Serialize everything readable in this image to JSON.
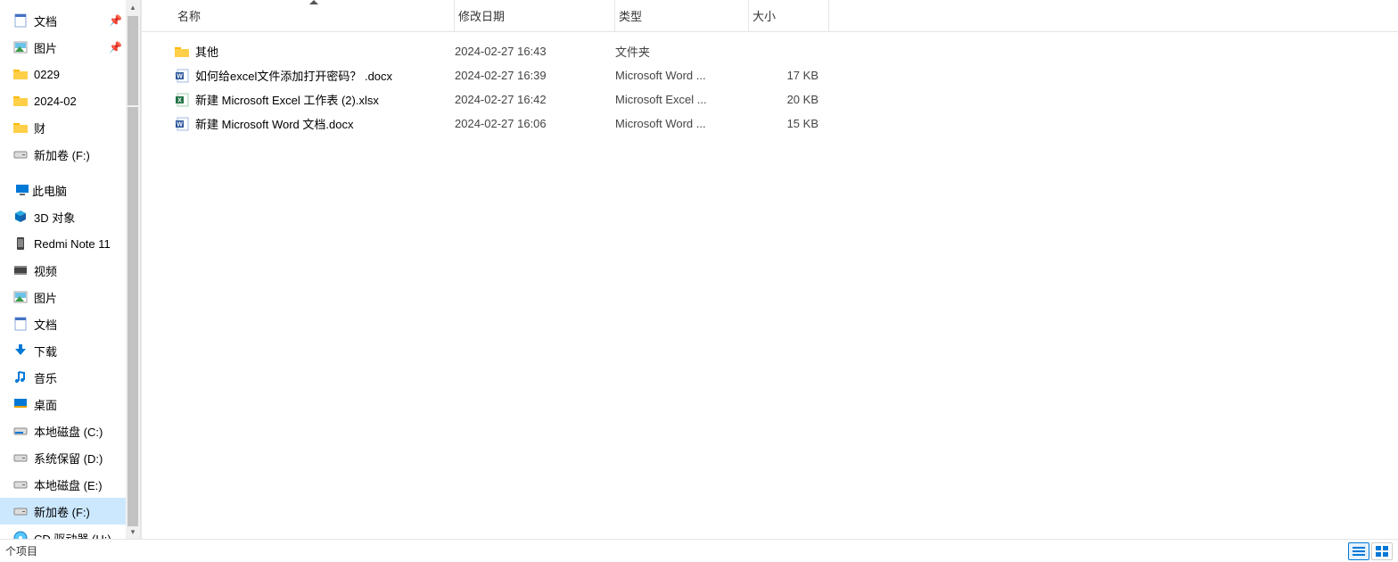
{
  "sidebar": {
    "quick": [
      {
        "label": "文档",
        "icon": "doc",
        "pin": true
      },
      {
        "label": "图片",
        "icon": "pic",
        "pin": true
      },
      {
        "label": "0229",
        "icon": "folder"
      },
      {
        "label": "2024-02",
        "icon": "folder"
      },
      {
        "label": "财",
        "icon": "folder"
      },
      {
        "label": "新加卷 (F:)",
        "icon": "drive"
      }
    ],
    "pc_label": "此电脑",
    "pc_children": [
      {
        "label": "3D 对象",
        "icon": "cube"
      },
      {
        "label": "Redmi Note 11",
        "icon": "phone"
      },
      {
        "label": "视频",
        "icon": "vid"
      },
      {
        "label": "图片",
        "icon": "pic"
      },
      {
        "label": "文档",
        "icon": "doc"
      },
      {
        "label": "下载",
        "icon": "dl"
      },
      {
        "label": "音乐",
        "icon": "mus"
      },
      {
        "label": "桌面",
        "icon": "desk"
      },
      {
        "label": "本地磁盘 (C:)",
        "icon": "driveC"
      },
      {
        "label": "系统保留 (D:)",
        "icon": "drive"
      },
      {
        "label": "本地磁盘 (E:)",
        "icon": "drive"
      },
      {
        "label": "新加卷 (F:)",
        "icon": "drive",
        "selected": true
      },
      {
        "label": "CD 驱动器 (H:) ",
        "icon": "cd"
      }
    ]
  },
  "columns": {
    "name": "名称",
    "date": "修改日期",
    "type": "类型",
    "size": "大小"
  },
  "files": [
    {
      "name": "其他",
      "date": "2024-02-27 16:43",
      "type": "文件夹",
      "size": "",
      "icon": "folder"
    },
    {
      "name": "如何给excel文件添加打开密码？ .docx",
      "date": "2024-02-27 16:39",
      "type": "Microsoft Word ...",
      "size": "17 KB",
      "icon": "word"
    },
    {
      "name": "新建 Microsoft Excel 工作表 (2).xlsx",
      "date": "2024-02-27 16:42",
      "type": "Microsoft Excel ...",
      "size": "20 KB",
      "icon": "excel"
    },
    {
      "name": "新建 Microsoft Word 文档.docx",
      "date": "2024-02-27 16:06",
      "type": "Microsoft Word ...",
      "size": "15 KB",
      "icon": "word"
    }
  ],
  "status": {
    "count_label": "个项目"
  }
}
